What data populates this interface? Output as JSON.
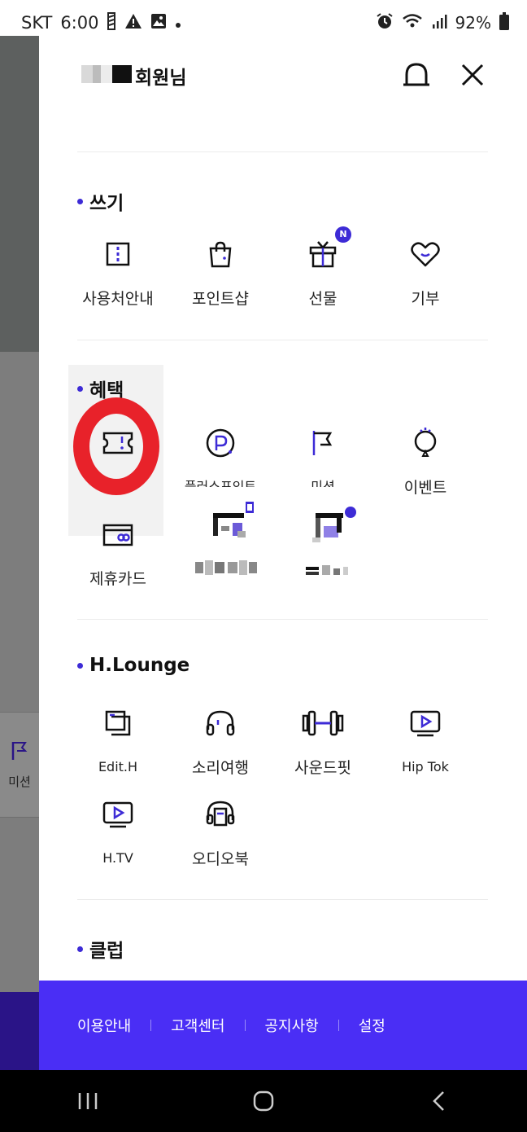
{
  "status_bar": {
    "carrier": "SKT",
    "time": "6:00",
    "battery": "92%"
  },
  "background_app": {
    "mission_label": "미션"
  },
  "header": {
    "member_suffix": "회원님"
  },
  "sections": {
    "write": {
      "title": "쓰기",
      "items": [
        {
          "label": "사용처안내",
          "icon": "map-icon"
        },
        {
          "label": "포인트샵",
          "icon": "shopping-bag-icon"
        },
        {
          "label": "선물",
          "icon": "gift-icon",
          "badge": "N"
        },
        {
          "label": "기부",
          "icon": "heart-icon"
        }
      ]
    },
    "benefit": {
      "title": "혜택",
      "items": [
        {
          "label": "",
          "icon": "ticket-icon"
        },
        {
          "label": "플러스포인트",
          "icon": "point-icon"
        },
        {
          "label": "미션",
          "icon": "flag-icon"
        },
        {
          "label": "이벤트",
          "icon": "balloon-icon"
        },
        {
          "label": "제휴카드",
          "icon": "card-icon"
        }
      ]
    },
    "lounge": {
      "title": "H.Lounge",
      "items": [
        {
          "label": "Edit.H",
          "icon": "edit-icon"
        },
        {
          "label": "소리여행",
          "icon": "headphones-icon"
        },
        {
          "label": "사운드핏",
          "icon": "dumbbell-icon"
        },
        {
          "label": "Hip Tok",
          "icon": "play-icon"
        },
        {
          "label": "H.TV",
          "icon": "tv-icon"
        },
        {
          "label": "오디오북",
          "icon": "audiobook-icon"
        }
      ]
    },
    "club": {
      "title": "클럽"
    }
  },
  "footer": {
    "links": [
      "이용안내",
      "고객센터",
      "공지사항",
      "설정"
    ]
  },
  "colors": {
    "accent": "#4a2ef5",
    "dot": "#3d2bd6",
    "annotation": "#e8222a"
  }
}
